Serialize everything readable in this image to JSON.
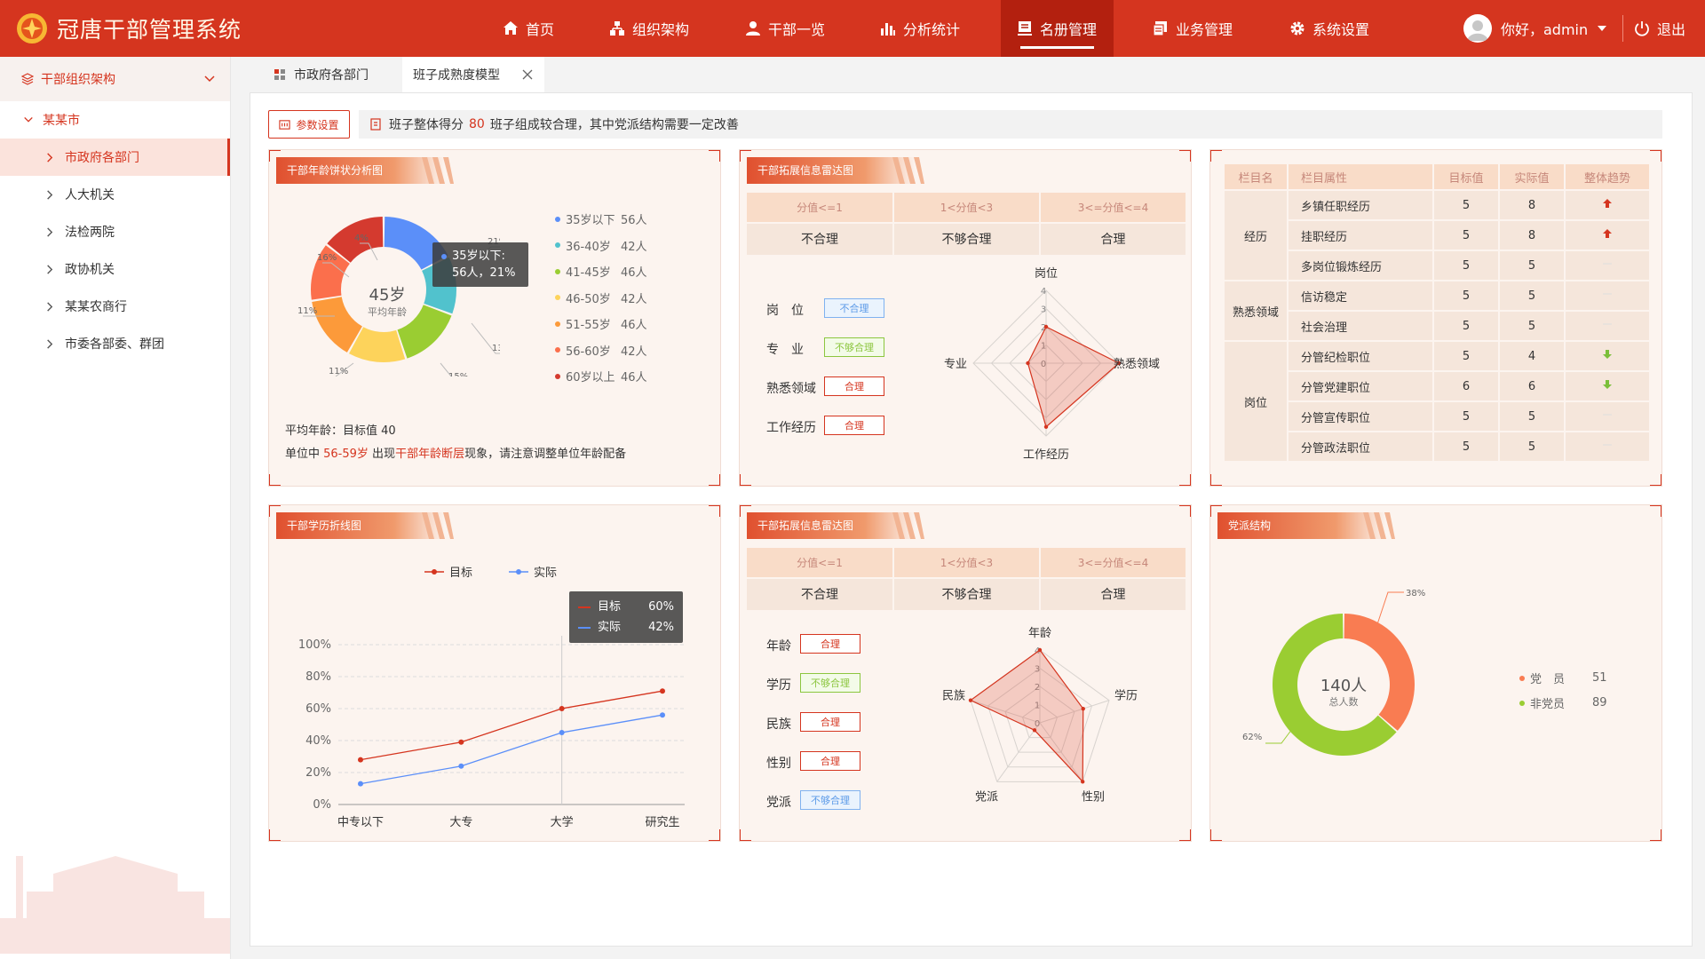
{
  "app": {
    "title": "冠唐干部管理系统"
  },
  "nav": {
    "items": [
      {
        "label": "首页",
        "icon": "home-icon"
      },
      {
        "label": "组织架构",
        "icon": "org-structure-icon"
      },
      {
        "label": "干部一览",
        "icon": "user-icon"
      },
      {
        "label": "分析统计",
        "icon": "bar-chart-icon"
      },
      {
        "label": "名册管理",
        "icon": "roster-icon",
        "active": true
      },
      {
        "label": "业务管理",
        "icon": "business-icon"
      },
      {
        "label": "系统设置",
        "icon": "gear-icon"
      }
    ],
    "greeting": "你好，admin",
    "logout": "退出"
  },
  "sidebar": {
    "header": "干部组织架构",
    "root": "某某市",
    "items": [
      "市政府各部门",
      "人大机关",
      "法检两院",
      "政协机关",
      "某某农商行",
      "市委各部委、群团"
    ]
  },
  "tabs": [
    "市政府各部门",
    "班子成熟度模型"
  ],
  "toolbar": {
    "param_button": "参数设置",
    "summary_prefix": "班子整体得分",
    "score": "80",
    "summary_suffix": "班子组成较合理，其中党派结构需要一定改善"
  },
  "age_panel": {
    "title": "干部年龄饼状分析图",
    "center_value": "45岁",
    "center_label": "平均年龄",
    "tooltip": {
      "title": "35岁以下:",
      "value": "56人，21%"
    },
    "legend": [
      {
        "label": "35岁以下",
        "value": "56人",
        "color": "#5b8ff9"
      },
      {
        "label": "36-40岁",
        "value": "42人",
        "color": "#51c2cd"
      },
      {
        "label": "41-45岁",
        "value": "46人",
        "color": "#9acd32"
      },
      {
        "label": "46-50岁",
        "value": "42人",
        "color": "#fdd35b"
      },
      {
        "label": "51-55岁",
        "value": "46人",
        "color": "#fc9a3a"
      },
      {
        "label": "56-60岁",
        "value": "42人",
        "color": "#fb6f4c"
      },
      {
        "label": "60岁以上",
        "value": "46人",
        "color": "#d43a2f"
      }
    ],
    "note1": "平均年龄：目标值 40",
    "note2_a": "单位中 ",
    "note2_b": "56-59岁",
    "note2_c": " 出现",
    "note2_d": "干部年龄断层",
    "note2_e": "现象，请注意调整单位年龄配备"
  },
  "radar1": {
    "title": "干部拓展信息雷达图",
    "levels": [
      "分值<=1",
      "1<分值<3",
      "3<=分值<=4"
    ],
    "level_labels": [
      "不合理",
      "不够合理",
      "合理"
    ],
    "tags": [
      {
        "label": "岗　位",
        "tag": "不合理",
        "style": "blue"
      },
      {
        "label": "专　业",
        "tag": "不够合理",
        "style": "green"
      },
      {
        "label": "熟悉领域",
        "tag": "合理",
        "style": "red"
      },
      {
        "label": "工作经历",
        "tag": "合理",
        "style": "red"
      }
    ],
    "axes": [
      "岗位",
      "熟悉领域",
      "工作经历",
      "专业"
    ],
    "ticks": [
      "4",
      "3",
      "2",
      "1",
      "0"
    ],
    "values": [
      2,
      4,
      3.5,
      1
    ]
  },
  "table_panel": {
    "headers": [
      "栏目名",
      "栏目属性",
      "目标值",
      "实际值",
      "整体趋势"
    ],
    "groups": [
      {
        "name": "经历",
        "rows": [
          {
            "attr": "乡镇任职经历",
            "target": "5",
            "actual": "8",
            "trend": "up"
          },
          {
            "attr": "挂职经历",
            "target": "5",
            "actual": "8",
            "trend": "up"
          },
          {
            "attr": "多岗位锻炼经历",
            "target": "5",
            "actual": "5",
            "trend": "flat"
          }
        ]
      },
      {
        "name": "熟悉领域",
        "rows": [
          {
            "attr": "信访稳定",
            "target": "5",
            "actual": "5",
            "trend": "flat"
          },
          {
            "attr": "社会治理",
            "target": "5",
            "actual": "5",
            "trend": "flat"
          }
        ]
      },
      {
        "name": "岗位",
        "rows": [
          {
            "attr": "分管纪检职位",
            "target": "5",
            "actual": "4",
            "trend": "down"
          },
          {
            "attr": "分管党建职位",
            "target": "6",
            "actual": "6",
            "trend": "down"
          },
          {
            "attr": "分管宣传职位",
            "target": "5",
            "actual": "5",
            "trend": "flat"
          },
          {
            "attr": "分管政法职位",
            "target": "5",
            "actual": "5",
            "trend": "flat"
          }
        ]
      }
    ]
  },
  "chart_data": {
    "type": "line",
    "title": "干部学历折线图",
    "categories": [
      "中专以下",
      "大专",
      "大学",
      "研究生"
    ],
    "series": [
      {
        "name": "目标",
        "values": [
          28,
          39,
          60,
          71
        ],
        "color": "#d5351f"
      },
      {
        "name": "实际",
        "values": [
          13,
          24,
          45,
          56
        ],
        "color": "#5b8ff9"
      }
    ],
    "ylim": [
      0,
      100
    ],
    "yticks": [
      "0%",
      "20%",
      "40%",
      "60%",
      "80%",
      "100%"
    ],
    "tooltip": {
      "rows": [
        {
          "name": "目标",
          "value": "60%"
        },
        {
          "name": "实际",
          "value": "42%"
        }
      ]
    }
  },
  "radar2": {
    "title": "干部拓展信息雷达图",
    "levels": [
      "分值<=1",
      "1<分值<3",
      "3<=分值<=4"
    ],
    "level_labels": [
      "不合理",
      "不够合理",
      "合理"
    ],
    "tags": [
      {
        "label": "年龄",
        "tag": "合理",
        "style": "red"
      },
      {
        "label": "学历",
        "tag": "不够合理",
        "style": "green"
      },
      {
        "label": "民族",
        "tag": "合理",
        "style": "red"
      },
      {
        "label": "性别",
        "tag": "合理",
        "style": "red"
      },
      {
        "label": "党派",
        "tag": "不够合理",
        "style": "blue"
      }
    ],
    "axes": [
      "年龄",
      "学历",
      "性别",
      "党派",
      "民族"
    ],
    "ticks": [
      "4",
      "3",
      "2",
      "1",
      "0"
    ],
    "values": [
      4,
      2.5,
      4,
      0.5,
      4
    ]
  },
  "party_panel": {
    "title": "党派结构",
    "center_value": "140人",
    "center_label": "总人数",
    "segments": [
      {
        "label": "党　员",
        "value": "51",
        "pct": "38%",
        "color": "#f97c52"
      },
      {
        "label": "非党员",
        "value": "89",
        "pct": "62%",
        "color": "#9acd32"
      }
    ]
  }
}
